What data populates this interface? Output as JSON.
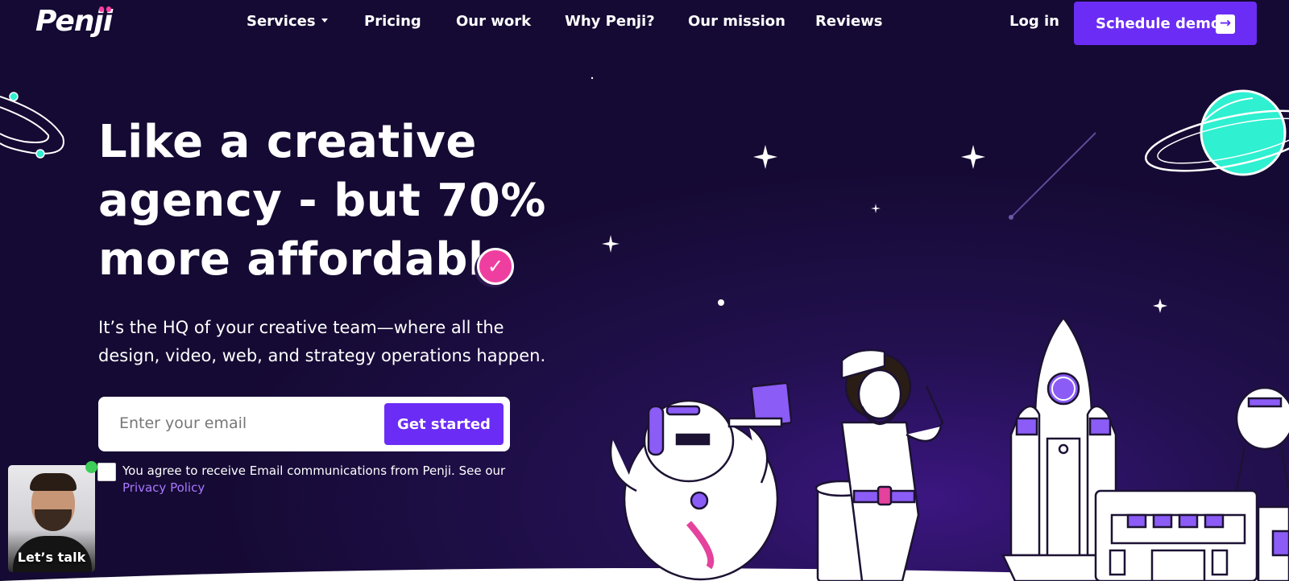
{
  "brand": {
    "name": "Penji"
  },
  "nav": {
    "items": [
      {
        "label": "Services",
        "has_dropdown": true
      },
      {
        "label": "Pricing"
      },
      {
        "label": "Our work"
      },
      {
        "label": "Why Penji?"
      },
      {
        "label": "Our mission"
      },
      {
        "label": "Reviews"
      }
    ],
    "login_label": "Log in",
    "demo_label": "Schedule demo"
  },
  "hero": {
    "title_lines": [
      "Like a creative",
      "agency - but 70%",
      "more affordable"
    ],
    "subtitle": "It’s the HQ of your creative team—where all the design, video, web, and strategy operations happen."
  },
  "signup": {
    "email_placeholder": "Enter your email",
    "email_value": "",
    "submit_label": "Get started",
    "consent_text": "You agree to receive Email communications from Penji. See our ",
    "privacy_link": "Privacy Policy",
    "consent_checked": false
  },
  "chat_widget": {
    "label": "Let’s talk",
    "online": true
  },
  "colors": {
    "background": "#150a33",
    "accent": "#6b2cf5",
    "badge_pink": "#ee3fa0",
    "planet": "#2ff0d0",
    "link": "#a978ff",
    "online": "#3dcd58"
  },
  "icons": {
    "dropdown": "caret-down-icon",
    "demo_arrow": "arrow-right-icon",
    "badge": "checkmark-icon"
  }
}
